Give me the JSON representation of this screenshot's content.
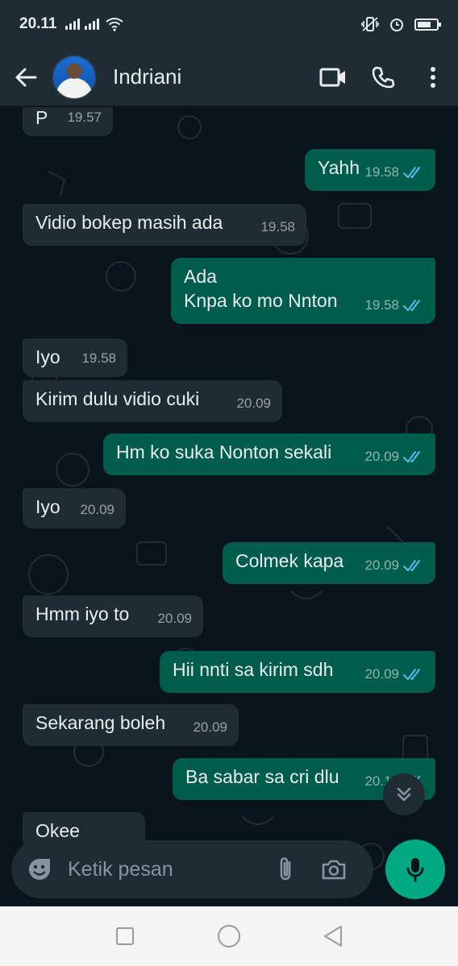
{
  "status_bar": {
    "time": "20.11"
  },
  "header": {
    "contact_name": "Indriani"
  },
  "messages": [
    {
      "dir": "in",
      "text": "P",
      "time": "19.57"
    },
    {
      "dir": "out",
      "text": "Yahh",
      "time": "19.58",
      "read": true
    },
    {
      "dir": "in",
      "text": "Vidio bokep masih ada",
      "time": "19.58"
    },
    {
      "dir": "out",
      "text": "Ada",
      "text2": "Knpa ko mo Nnton",
      "time": "19.58",
      "read": true
    },
    {
      "dir": "in",
      "text": "Iyo",
      "time": "19.58"
    },
    {
      "dir": "in",
      "text": "Kirim dulu vidio cuki",
      "time": "20.09"
    },
    {
      "dir": "out",
      "text": "Hm ko suka Nonton sekali",
      "time": "20.09",
      "read": true
    },
    {
      "dir": "in",
      "text": "Iyo",
      "time": "20.09"
    },
    {
      "dir": "out",
      "text": "Colmek kapa",
      "time": "20.09",
      "read": true
    },
    {
      "dir": "in",
      "text": "Hmm iyo to",
      "time": "20.09"
    },
    {
      "dir": "out",
      "text": "Hii nnti sa kirim sdh",
      "time": "20.09",
      "read": true
    },
    {
      "dir": "in",
      "text": "Sekarang boleh",
      "time": "20.09"
    },
    {
      "dir": "out",
      "text": "Ba sabar sa cri dlu",
      "time": "20.10",
      "read": true
    },
    {
      "dir": "in",
      "text": "Okee",
      "time": ""
    }
  ],
  "composer": {
    "placeholder": "Ketik pesan"
  },
  "colors": {
    "incoming_bubble": "#202c33",
    "outgoing_bubble": "#005c4b",
    "read_tick": "#53bdeb",
    "accent": "#00a884",
    "header_bg": "#1f2c34"
  },
  "icons": {
    "back": "arrow-left-icon",
    "video": "video-call-icon",
    "call": "phone-icon",
    "menu": "more-vert-icon",
    "emoji": "emoji-icon",
    "attach": "paperclip-icon",
    "camera": "camera-icon",
    "mic": "microphone-icon",
    "scroll": "double-chevron-down-icon"
  }
}
